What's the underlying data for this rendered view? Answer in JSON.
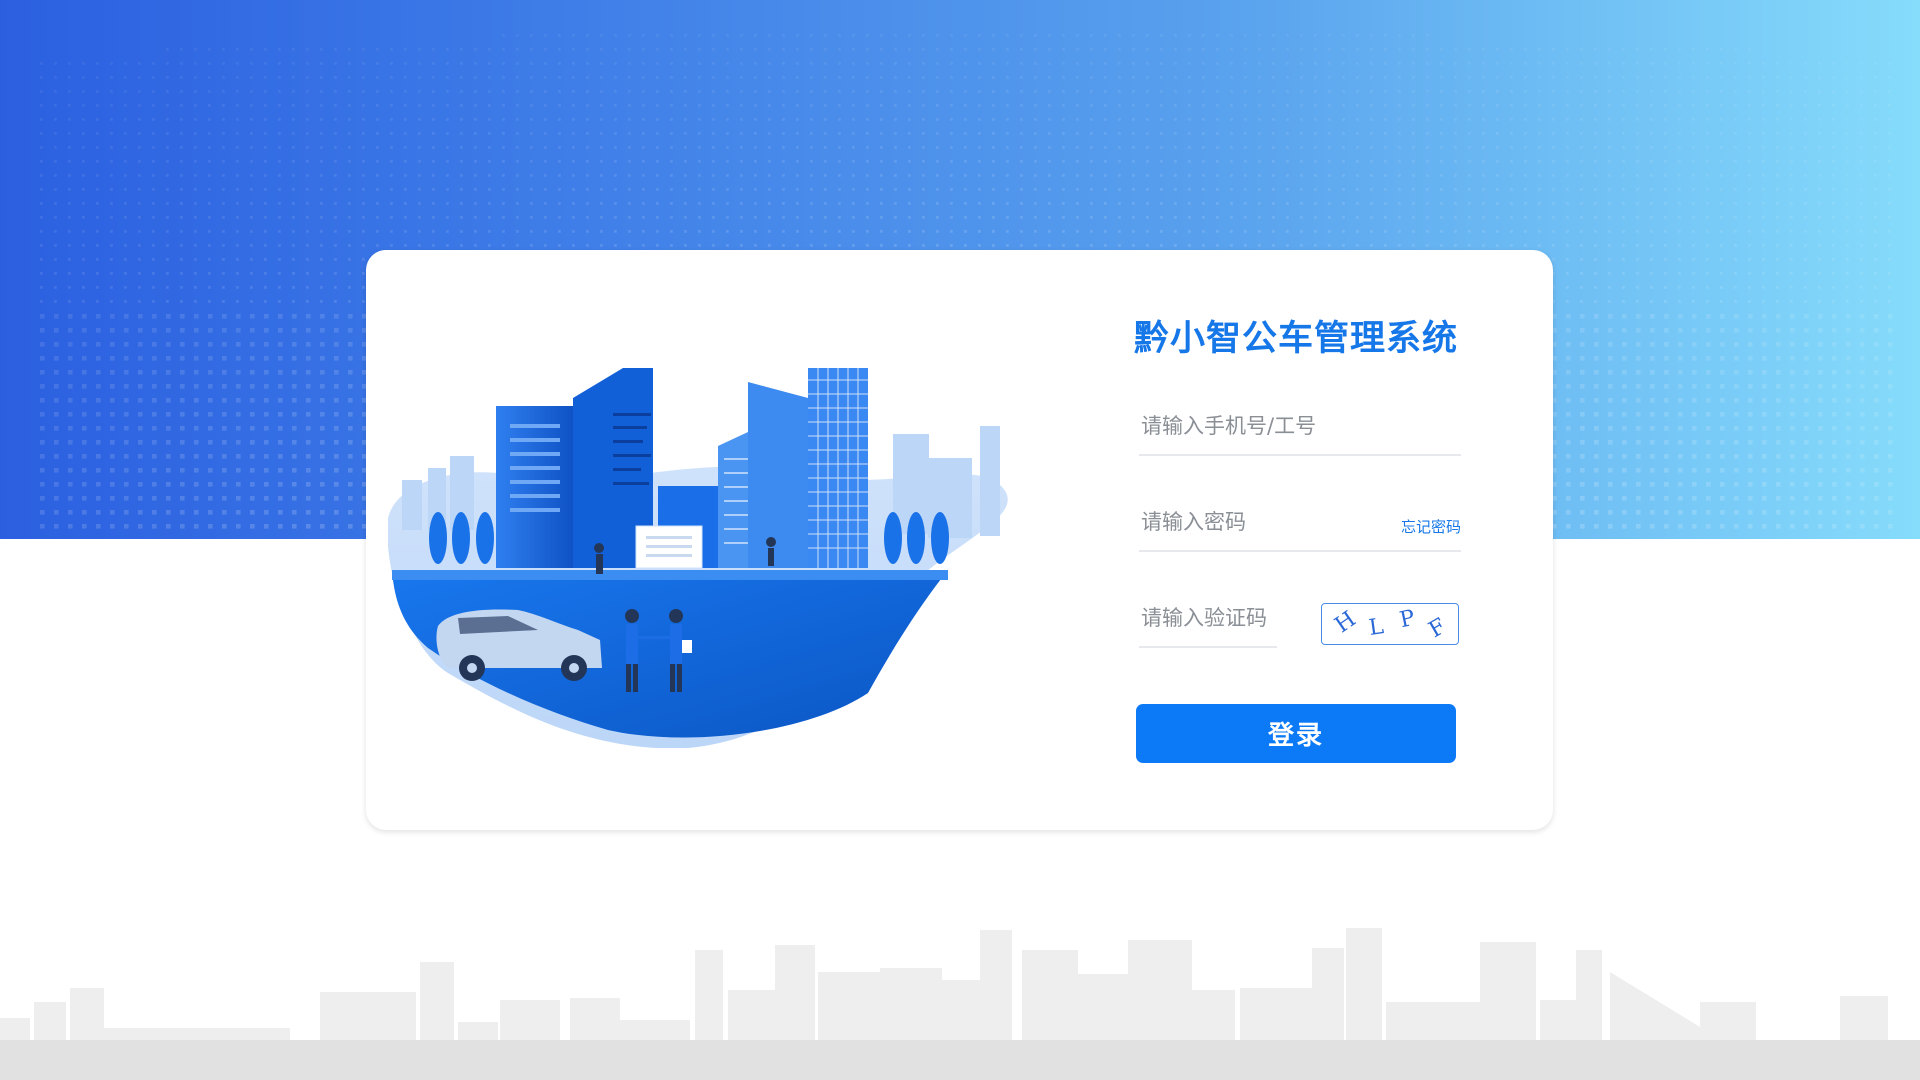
{
  "app": {
    "title": "黔小智公车管理系统"
  },
  "login_form": {
    "phone_placeholder": "请输入手机号/工号",
    "password_placeholder": "请输入密码",
    "forgot_password_label": "忘记密码",
    "captcha_placeholder": "请输入验证码",
    "captcha_chars": [
      "H",
      "L",
      "P",
      "F"
    ],
    "login_button_label": "登录"
  },
  "colors": {
    "accent": "#0c79f7",
    "title": "#1677e8",
    "header_gradient_start": "#2b5fe0",
    "header_gradient_end": "#86dcfb"
  },
  "icons": {
    "hero": "city-business-illustration",
    "background": "city-skyline"
  }
}
